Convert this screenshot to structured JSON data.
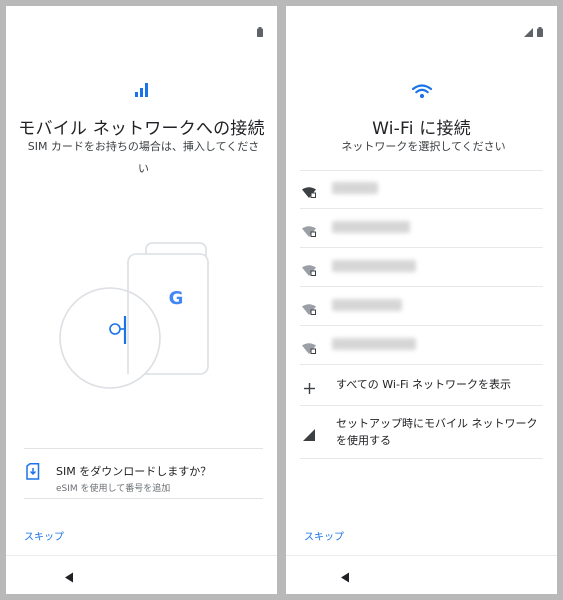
{
  "left": {
    "title": "モバイル ネットワークへの接続",
    "subtitle": "SIM カードをお持ちの場合は、挿入してください",
    "illustration_logo": "G",
    "download_option": {
      "label": "SIM をダウンロードしますか？",
      "sublabel": "eSIM を使用して番号を追加"
    },
    "skip": "スキップ",
    "icons": {
      "header": "signal-bars-icon",
      "status": "battery-icon",
      "download": "sim-download-icon"
    },
    "accent_color": "#1a73e8"
  },
  "right": {
    "title": "Wi-Fi に接続",
    "subtitle": "ネットワークを選択してください",
    "networks_count": 5,
    "show_all": "すべての Wi-Fi ネットワークを表示",
    "mobile_option": "セットアップ時にモバイル ネットワークを使用する",
    "skip": "スキップ",
    "icons": {
      "header": "wifi-icon",
      "status": [
        "signal-icon",
        "battery-icon"
      ],
      "network": "wifi-locked-icon",
      "show_all": "plus-icon",
      "mobile": "cellular-signal-icon"
    }
  }
}
